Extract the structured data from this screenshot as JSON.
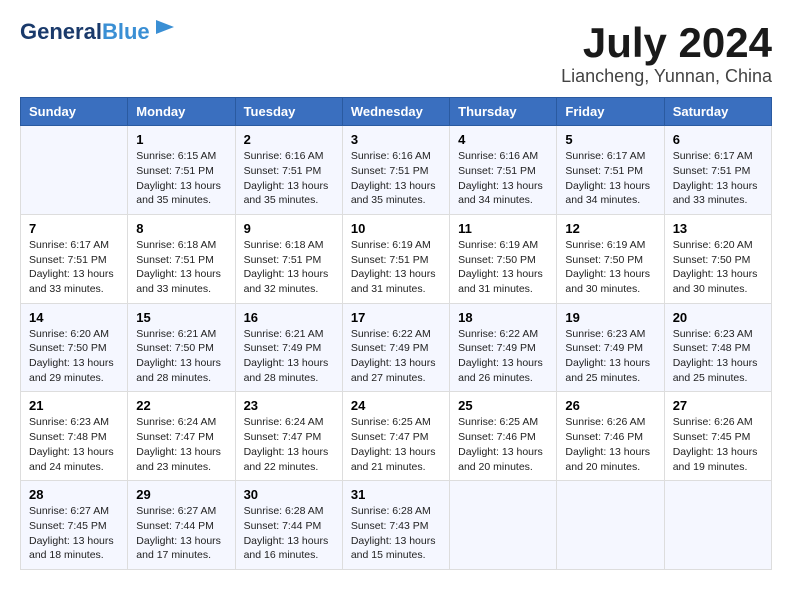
{
  "logo": {
    "line1": "General",
    "line2": "Blue"
  },
  "title": "July 2024",
  "location": "Liancheng, Yunnan, China",
  "weekdays": [
    "Sunday",
    "Monday",
    "Tuesday",
    "Wednesday",
    "Thursday",
    "Friday",
    "Saturday"
  ],
  "weeks": [
    [
      {
        "day": "",
        "info": ""
      },
      {
        "day": "1",
        "info": "Sunrise: 6:15 AM\nSunset: 7:51 PM\nDaylight: 13 hours\nand 35 minutes."
      },
      {
        "day": "2",
        "info": "Sunrise: 6:16 AM\nSunset: 7:51 PM\nDaylight: 13 hours\nand 35 minutes."
      },
      {
        "day": "3",
        "info": "Sunrise: 6:16 AM\nSunset: 7:51 PM\nDaylight: 13 hours\nand 35 minutes."
      },
      {
        "day": "4",
        "info": "Sunrise: 6:16 AM\nSunset: 7:51 PM\nDaylight: 13 hours\nand 34 minutes."
      },
      {
        "day": "5",
        "info": "Sunrise: 6:17 AM\nSunset: 7:51 PM\nDaylight: 13 hours\nand 34 minutes."
      },
      {
        "day": "6",
        "info": "Sunrise: 6:17 AM\nSunset: 7:51 PM\nDaylight: 13 hours\nand 33 minutes."
      }
    ],
    [
      {
        "day": "7",
        "info": "Sunrise: 6:17 AM\nSunset: 7:51 PM\nDaylight: 13 hours\nand 33 minutes."
      },
      {
        "day": "8",
        "info": "Sunrise: 6:18 AM\nSunset: 7:51 PM\nDaylight: 13 hours\nand 33 minutes."
      },
      {
        "day": "9",
        "info": "Sunrise: 6:18 AM\nSunset: 7:51 PM\nDaylight: 13 hours\nand 32 minutes."
      },
      {
        "day": "10",
        "info": "Sunrise: 6:19 AM\nSunset: 7:51 PM\nDaylight: 13 hours\nand 31 minutes."
      },
      {
        "day": "11",
        "info": "Sunrise: 6:19 AM\nSunset: 7:50 PM\nDaylight: 13 hours\nand 31 minutes."
      },
      {
        "day": "12",
        "info": "Sunrise: 6:19 AM\nSunset: 7:50 PM\nDaylight: 13 hours\nand 30 minutes."
      },
      {
        "day": "13",
        "info": "Sunrise: 6:20 AM\nSunset: 7:50 PM\nDaylight: 13 hours\nand 30 minutes."
      }
    ],
    [
      {
        "day": "14",
        "info": "Sunrise: 6:20 AM\nSunset: 7:50 PM\nDaylight: 13 hours\nand 29 minutes."
      },
      {
        "day": "15",
        "info": "Sunrise: 6:21 AM\nSunset: 7:50 PM\nDaylight: 13 hours\nand 28 minutes."
      },
      {
        "day": "16",
        "info": "Sunrise: 6:21 AM\nSunset: 7:49 PM\nDaylight: 13 hours\nand 28 minutes."
      },
      {
        "day": "17",
        "info": "Sunrise: 6:22 AM\nSunset: 7:49 PM\nDaylight: 13 hours\nand 27 minutes."
      },
      {
        "day": "18",
        "info": "Sunrise: 6:22 AM\nSunset: 7:49 PM\nDaylight: 13 hours\nand 26 minutes."
      },
      {
        "day": "19",
        "info": "Sunrise: 6:23 AM\nSunset: 7:49 PM\nDaylight: 13 hours\nand 25 minutes."
      },
      {
        "day": "20",
        "info": "Sunrise: 6:23 AM\nSunset: 7:48 PM\nDaylight: 13 hours\nand 25 minutes."
      }
    ],
    [
      {
        "day": "21",
        "info": "Sunrise: 6:23 AM\nSunset: 7:48 PM\nDaylight: 13 hours\nand 24 minutes."
      },
      {
        "day": "22",
        "info": "Sunrise: 6:24 AM\nSunset: 7:47 PM\nDaylight: 13 hours\nand 23 minutes."
      },
      {
        "day": "23",
        "info": "Sunrise: 6:24 AM\nSunset: 7:47 PM\nDaylight: 13 hours\nand 22 minutes."
      },
      {
        "day": "24",
        "info": "Sunrise: 6:25 AM\nSunset: 7:47 PM\nDaylight: 13 hours\nand 21 minutes."
      },
      {
        "day": "25",
        "info": "Sunrise: 6:25 AM\nSunset: 7:46 PM\nDaylight: 13 hours\nand 20 minutes."
      },
      {
        "day": "26",
        "info": "Sunrise: 6:26 AM\nSunset: 7:46 PM\nDaylight: 13 hours\nand 20 minutes."
      },
      {
        "day": "27",
        "info": "Sunrise: 6:26 AM\nSunset: 7:45 PM\nDaylight: 13 hours\nand 19 minutes."
      }
    ],
    [
      {
        "day": "28",
        "info": "Sunrise: 6:27 AM\nSunset: 7:45 PM\nDaylight: 13 hours\nand 18 minutes."
      },
      {
        "day": "29",
        "info": "Sunrise: 6:27 AM\nSunset: 7:44 PM\nDaylight: 13 hours\nand 17 minutes."
      },
      {
        "day": "30",
        "info": "Sunrise: 6:28 AM\nSunset: 7:44 PM\nDaylight: 13 hours\nand 16 minutes."
      },
      {
        "day": "31",
        "info": "Sunrise: 6:28 AM\nSunset: 7:43 PM\nDaylight: 13 hours\nand 15 minutes."
      },
      {
        "day": "",
        "info": ""
      },
      {
        "day": "",
        "info": ""
      },
      {
        "day": "",
        "info": ""
      }
    ]
  ]
}
